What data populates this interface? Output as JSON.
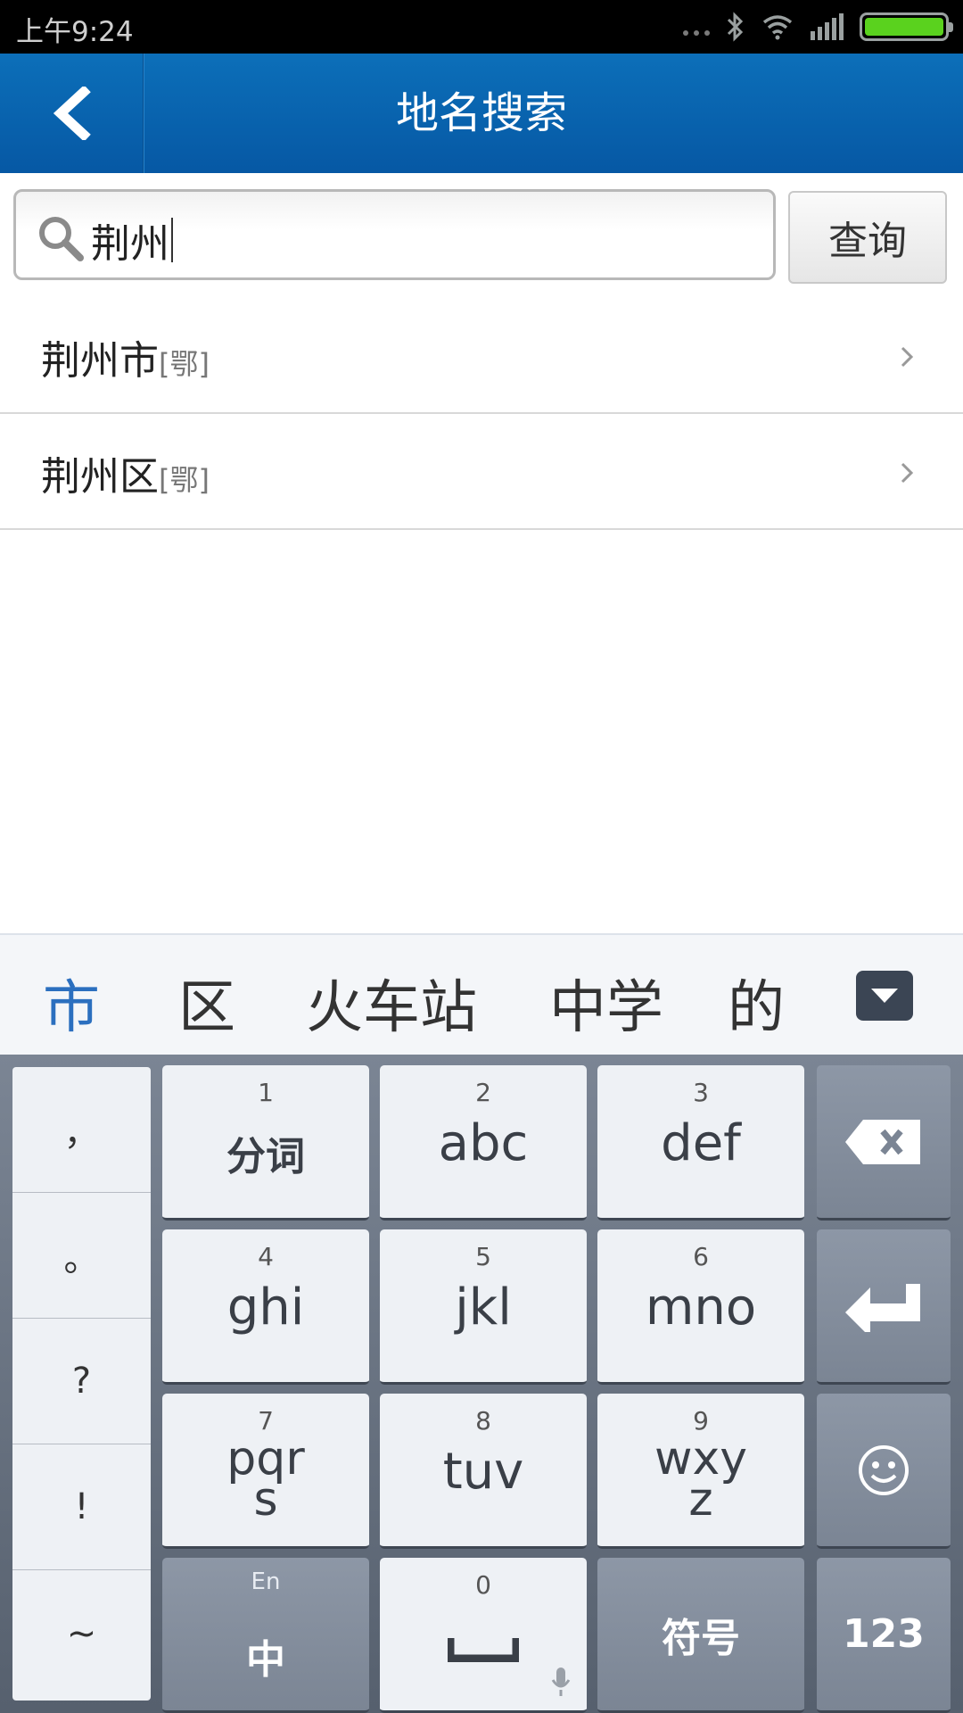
{
  "status_bar": {
    "time": "上午9:24"
  },
  "header": {
    "title": "地名搜索"
  },
  "search": {
    "value": "荆州",
    "button_label": "查询"
  },
  "results": [
    {
      "name": "荆州市",
      "province": "[鄂]"
    },
    {
      "name": "荆州区",
      "province": "[鄂]"
    }
  ],
  "keyboard": {
    "candidates": [
      "市",
      "区",
      "火车站",
      "中学",
      "的"
    ],
    "punctuation": [
      "，",
      "。",
      "?",
      "!",
      "~"
    ],
    "keys": [
      {
        "num": "1",
        "label": "分词"
      },
      {
        "num": "2",
        "label": "abc"
      },
      {
        "num": "3",
        "label": "def"
      },
      {
        "num": "4",
        "label": "ghi"
      },
      {
        "num": "5",
        "label": "jkl"
      },
      {
        "num": "6",
        "label": "mno"
      },
      {
        "num": "7",
        "label": "pqr\ns"
      },
      {
        "num": "8",
        "label": "tuv"
      },
      {
        "num": "9",
        "label": "wxy\nz"
      }
    ],
    "lang_top": "En",
    "lang_bottom": "中",
    "space_num": "0",
    "symbol_label": "符号",
    "numeric_label": "123"
  },
  "colors": {
    "header_blue": "#0658a4",
    "candidate_highlight": "#2b6fbf",
    "battery_green": "#5ad21e"
  }
}
